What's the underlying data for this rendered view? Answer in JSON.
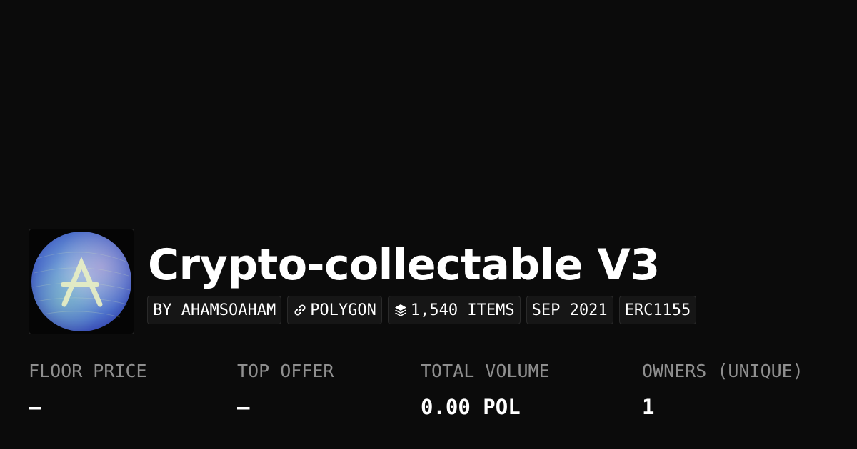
{
  "collection": {
    "title": "Crypto-collectable V3",
    "avatar_icon": "aave-logo-icon"
  },
  "badges": {
    "creator": "BY AHAMSOAHAM",
    "chain": "POLYGON",
    "chain_icon": "link-icon",
    "items": "1,540 ITEMS",
    "items_icon": "layers-icon",
    "date": "SEP 2021",
    "standard": "ERC1155"
  },
  "stats": {
    "floor_price": {
      "label": "FLOOR PRICE",
      "value": "–"
    },
    "top_offer": {
      "label": "TOP OFFER",
      "value": "–"
    },
    "total_volume": {
      "label": "TOTAL VOLUME",
      "value": "0.00 POL"
    },
    "owners": {
      "label": "OWNERS (UNIQUE)",
      "value": "1"
    }
  },
  "colors": {
    "background": "#0b0b0b",
    "label": "#8f8f8f",
    "badge_bg": "#161616",
    "badge_border": "#2a2a2a",
    "avatar_accent": "#5f8fd6"
  }
}
